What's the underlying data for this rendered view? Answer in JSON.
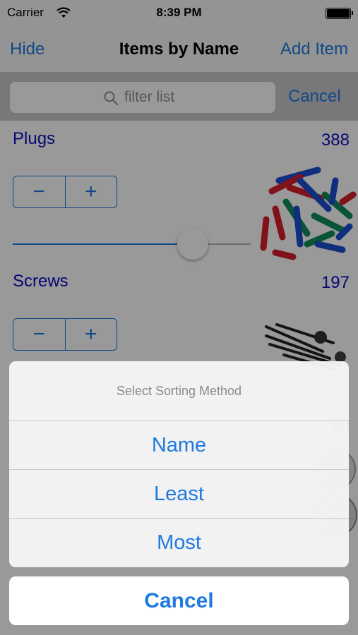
{
  "status_bar": {
    "carrier": "Carrier",
    "time": "8:39 PM"
  },
  "nav": {
    "left_button": "Hide",
    "title": "Items by Name",
    "right_button": "Add Item"
  },
  "search": {
    "placeholder": "filter list",
    "cancel_label": "Cancel"
  },
  "items": [
    {
      "name": "Plugs",
      "count": "388",
      "stepper_minus": "−",
      "stepper_plus": "+",
      "slider_value": 0.75,
      "image_icon": "wall-plugs-image"
    },
    {
      "name": "Screws",
      "count": "197",
      "stepper_minus": "−",
      "stepper_plus": "+",
      "image_icon": "screws-image"
    },
    {
      "count": "30",
      "image_icon": "washers-image"
    }
  ],
  "action_sheet": {
    "title": "Select Sorting Method",
    "options": [
      "Name",
      "Least",
      "Most"
    ],
    "cancel_label": "Cancel"
  },
  "colors": {
    "tint": "#1f7ae0",
    "item_text": "#0b0bc4"
  }
}
